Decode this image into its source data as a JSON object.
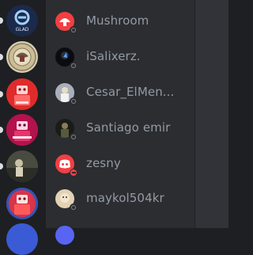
{
  "servers": [
    {
      "name": "GLAD",
      "color": "#1b2a4a"
    },
    {
      "name": "seal",
      "color": "#d9cfb5"
    },
    {
      "name": "red-robot-1",
      "color": "#e02b2b"
    },
    {
      "name": "red-robot-2",
      "color": "#c0208a"
    },
    {
      "name": "photo",
      "color": "#3a3b33"
    },
    {
      "name": "red-robot-3",
      "color": "#b71c3c"
    }
  ],
  "server_logo_text": "GLAD",
  "members": [
    {
      "name": "Mushroom",
      "status": "offline"
    },
    {
      "name": "iSalixerz.",
      "status": "offline"
    },
    {
      "name": "Cesar_ElMen...",
      "status": "offline"
    },
    {
      "name": "Santiago emir",
      "status": "offline"
    },
    {
      "name": "zesny",
      "status": "dnd"
    },
    {
      "name": "maykol504kr",
      "status": "offline"
    }
  ],
  "colors": {
    "rail_bg": "#1e1f22",
    "list_bg": "#2b2d31",
    "name_muted": "#949ba4",
    "discord_red": "#f23f43"
  }
}
